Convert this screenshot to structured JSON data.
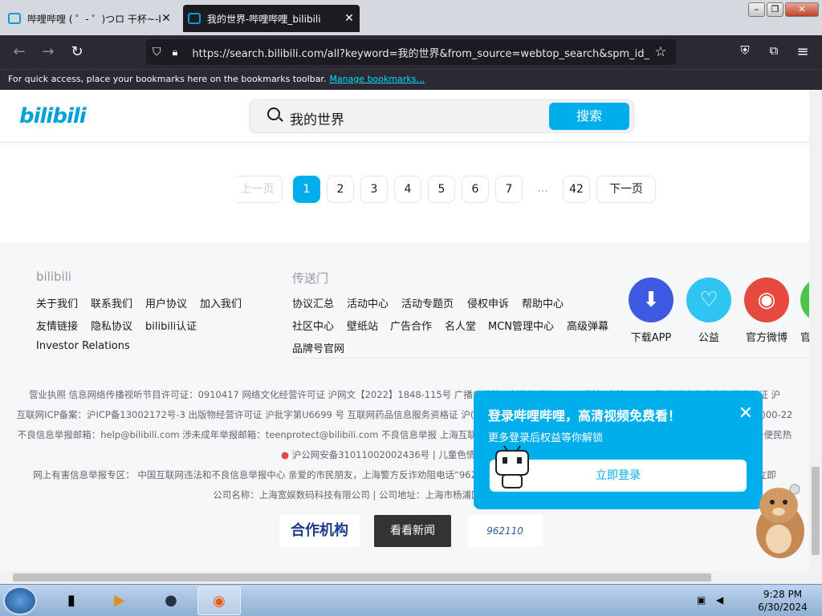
{
  "browser": {
    "tabs": [
      {
        "title": "哔哩哔哩 ( ゜- ゜)つロ 干杯~-bil",
        "active": false
      },
      {
        "title": "我的世界-哔哩哔哩_bilibili",
        "active": true
      }
    ],
    "url": "https://search.bilibili.com/all?keyword=我的世界&from_source=webtop_search&spm_id_from",
    "bookmarks_hint": "For quick access, place your bookmarks here on the bookmarks toolbar.",
    "bookmarks_link": "Manage bookmarks..."
  },
  "header": {
    "logo": "bilibili",
    "search_value": "我的世界",
    "search_button": "搜索"
  },
  "pager": {
    "prev": "上一页",
    "pages": [
      "1",
      "2",
      "3",
      "4",
      "5",
      "6",
      "7"
    ],
    "ellipsis": "...",
    "last": "42",
    "next": "下一页",
    "current": "1"
  },
  "footer": {
    "col1_title": "bilibili",
    "col1_links": [
      "关于我们",
      "联系我们",
      "用户协议",
      "加入我们",
      "友情链接",
      "隐私协议",
      "bilibili认证",
      "Investor Relations"
    ],
    "col2_title": "传送门",
    "col2_links": [
      "协议汇总",
      "活动中心",
      "活动专题页",
      "侵权申诉",
      "帮助中心",
      "社区中心",
      "壁纸站",
      "广告合作",
      "名人堂",
      "MCN管理中心",
      "高级弹幕",
      "品牌号官网"
    ],
    "apps": [
      {
        "label": "下载APP",
        "color": "#3d5ae0"
      },
      {
        "label": "公益",
        "color": "#2ec5f0"
      },
      {
        "label": "官方微博",
        "color": "#e6493d"
      },
      {
        "label": "官",
        "color": "#4cc34a"
      }
    ],
    "license_lines": [
      "营业执照  信息网络传播视听节目许可证：0910417  网络文化经营许可证 沪网文【2022】1848-115号  广播电视节目制作经营许可证：（沪）字第01248号  增值电信业务经营许可证 沪",
      "互联网ICP备案：沪ICP备13002172号-3  出版物经营许可证 沪批字第U6699 号  互联网药品信息服务资格证 沪(经营性)-2018-0004  违法和不良信息举报电话：4000233233转3  (经)00-22",
      "不良信息举报邮箱：help@bilibili.com  涉未成年举报邮箱：teenprotect@bilibili.com  不良信息举报  上海互联网举报中心  网上有害信息举报专区  12318全国文化市场举报网站  服务便民热",
      "沪公网安备31011002002436号 | 儿童色情信息举报专区",
      "网上有害信息举报专区：  中国互联网违法和不良信息举报中心  亲爱的市民朋友，上海警方反诈劝阻电话“962110”系专门针对避免您财产被骗受损而设置，请您一旦接到此来电，立即",
      "公司名称：上海宽娱数码科技有限公司 | 公司地址：上海市杨浦区政立路485号国正中心3号楼"
    ],
    "partners": [
      "合作机构",
      "看看新闻",
      "962110"
    ]
  },
  "popup": {
    "title": "登录哔哩哔哩，高清视频免费看！",
    "subtitle": "更多登录后权益等你解锁",
    "button": "立即登录"
  },
  "taskbar": {
    "time": "9:28 PM",
    "date": "6/30/2024"
  }
}
